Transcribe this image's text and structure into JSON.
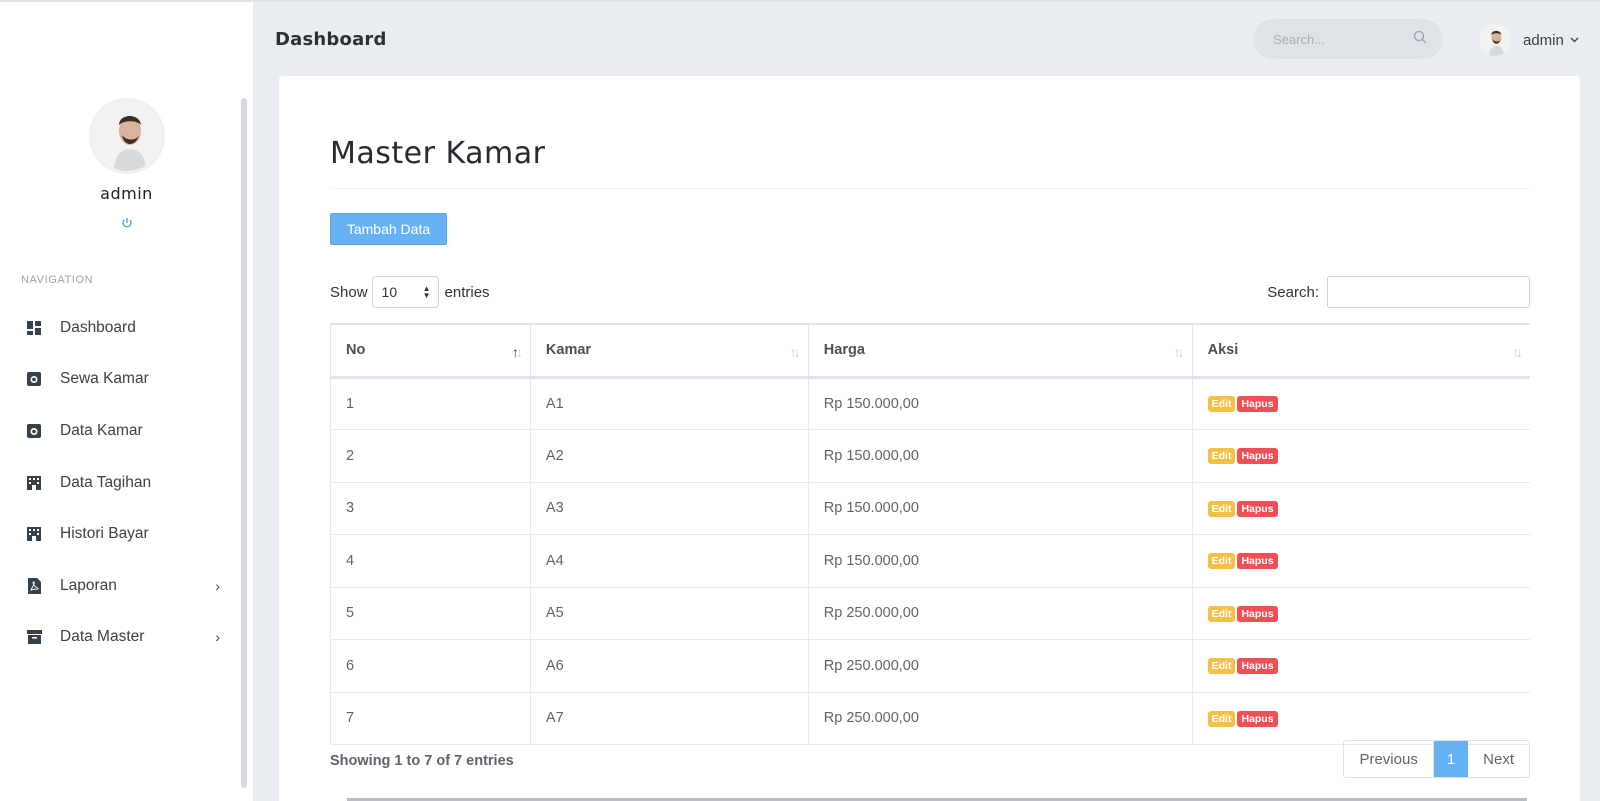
{
  "sidebar": {
    "profile_name": "admin",
    "nav_title": "NAVIGATION",
    "items": [
      {
        "label": "Dashboard",
        "icon": "dashboard-icon"
      },
      {
        "label": "Sewa Kamar",
        "icon": "camera-icon"
      },
      {
        "label": "Data Kamar",
        "icon": "camera-icon"
      },
      {
        "label": "Data Tagihan",
        "icon": "building-icon"
      },
      {
        "label": "Histori Bayar",
        "icon": "building-icon"
      },
      {
        "label": "Laporan",
        "icon": "pdf-file-icon",
        "has_submenu": true
      },
      {
        "label": "Data Master",
        "icon": "archive-icon",
        "has_submenu": true
      }
    ]
  },
  "topbar": {
    "title": "Dashboard",
    "search_placeholder": "Search...",
    "user_name": "admin"
  },
  "main": {
    "page_title": "Master Kamar",
    "add_button_label": "Tambah Data",
    "show_label": "Show",
    "entries_value": "10",
    "entries_label": "entries",
    "search_label": "Search:",
    "columns": [
      "No",
      "Kamar",
      "Harga",
      "Aksi"
    ],
    "rows": [
      {
        "no": "1",
        "kamar": "A1",
        "harga": "Rp 150.000,00"
      },
      {
        "no": "2",
        "kamar": "A2",
        "harga": "Rp 150.000,00"
      },
      {
        "no": "3",
        "kamar": "A3",
        "harga": "Rp 150.000,00"
      },
      {
        "no": "4",
        "kamar": "A4",
        "harga": "Rp 150.000,00"
      },
      {
        "no": "5",
        "kamar": "A5",
        "harga": "Rp 250.000,00"
      },
      {
        "no": "6",
        "kamar": "A6",
        "harga": "Rp 250.000,00"
      },
      {
        "no": "7",
        "kamar": "A7",
        "harga": "Rp 250.000,00"
      }
    ],
    "edit_label": "Edit",
    "hapus_label": "Hapus",
    "info": "Showing 1 to 7 of 7 entries",
    "pager": {
      "previous": "Previous",
      "current": "1",
      "next": "Next"
    }
  },
  "colors": {
    "accent": "#66b1f3",
    "edit_badge": "#f4c046",
    "hapus_badge": "#ef4f55",
    "background": "#e9edf1"
  }
}
